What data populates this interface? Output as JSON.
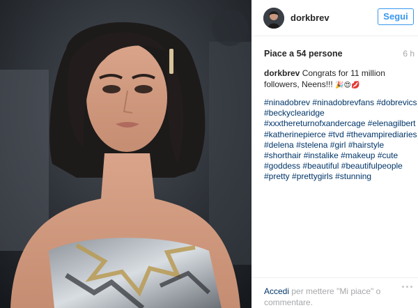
{
  "post": {
    "image_alt": "Photo of a woman with wavy shoulder-length dark hair in a sequined strapless dress",
    "colors": {
      "accent": "#3897f0",
      "link": "#003569",
      "muted": "#a5a7aa"
    }
  },
  "header": {
    "username": "dorkbrev",
    "follow_label": "Segui",
    "avatar_icon": "profile-avatar"
  },
  "stats": {
    "likes": "Piace a 54 persone",
    "age": "6 h"
  },
  "caption": {
    "username": "dorkbrev",
    "text": "Congrats for 11 million followers, Neens!!!",
    "emojis": "🎉😍💋"
  },
  "hashtags": [
    "#ninadobrev",
    "#ninadobrevfans",
    "#dobrevics",
    "#beckyclearidge",
    "#xxxthereturnofxandercage",
    "#elenagilbert",
    "#katherinepierce",
    "#tvd",
    "#thevampirediaries",
    "#delena",
    "#stelena",
    "#girl",
    "#hairstyle",
    "#shorthair",
    "#instalike",
    "#makeup",
    "#cute",
    "#goddess",
    "#beautiful",
    "#beautifulpeople",
    "#pretty",
    "#prettygirls",
    "#stunning"
  ],
  "footer": {
    "login_link": "Accedi",
    "login_text": "per mettere \"Mi piace\" o commentare.",
    "more_icon": "ellipsis-icon"
  }
}
